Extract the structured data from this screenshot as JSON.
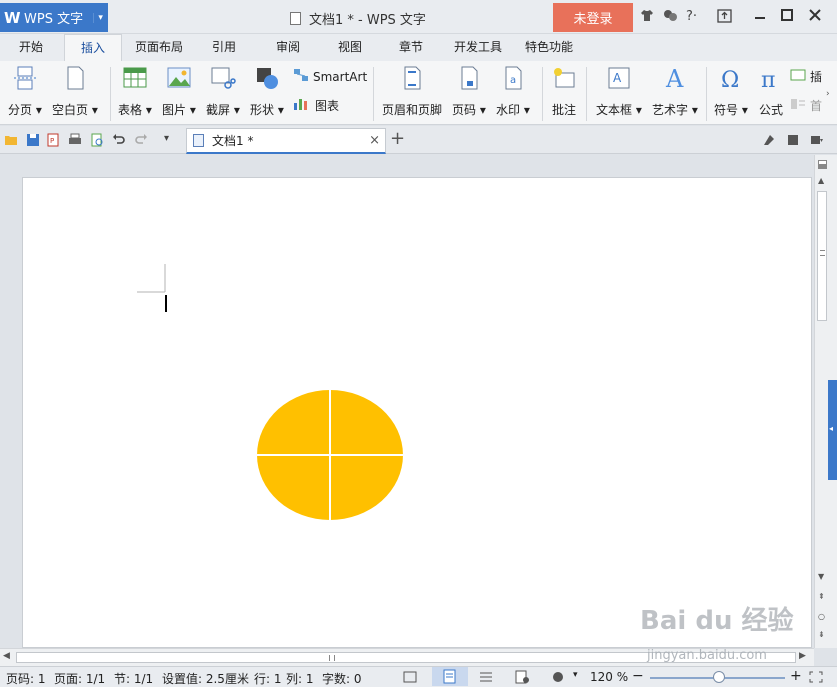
{
  "app": {
    "logo": "W",
    "name": "WPS 文字",
    "dropdown": "▾"
  },
  "title": "文档1 * - WPS 文字",
  "login": "未登录",
  "title_icons": {
    "help": "?·"
  },
  "menu_tabs": [
    "开始",
    "插入",
    "页面布局",
    "引用",
    "审阅",
    "视图",
    "章节",
    "开发工具",
    "特色功能"
  ],
  "ribbon": {
    "page_break": "分页",
    "blank_page": "空白页",
    "table": "表格",
    "picture": "图片",
    "screenshot": "截屏",
    "shapes": "形状",
    "smartart": "SmartArt",
    "chart": "图表",
    "header_footer": "页眉和页脚",
    "page_number": "页码",
    "watermark": "水印",
    "comment": "批注",
    "textbox": "文本框",
    "wordart": "艺术字",
    "symbol": "符号",
    "formula": "公式",
    "insert_more": "插",
    "first_more": "首"
  },
  "doc_tab": {
    "name": "文档1 *",
    "close": "×",
    "add": "+"
  },
  "status": {
    "page_code": "页码: 1",
    "pages": "页面: 1/1",
    "section": "节: 1/1",
    "setting": "设置值: 2.5厘米",
    "row": "行: 1",
    "col": "列: 1",
    "words": "字数: 0",
    "zoom": "120 %"
  },
  "watermark": {
    "brand": "Bai du 经验",
    "url": "jingyan.baidu.com"
  },
  "colors": {
    "accent": "#3b78c9",
    "login": "#e8715a",
    "shape_fill": "#ffc000"
  }
}
